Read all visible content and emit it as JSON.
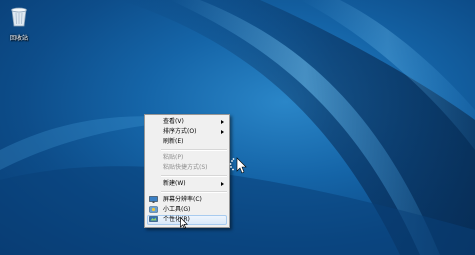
{
  "desktop": {
    "icons": [
      {
        "label": "回收站",
        "icon": "recycle-bin-icon"
      }
    ],
    "colors": {
      "background": "#1565a8",
      "accent": "#2a86c8"
    }
  },
  "context_menu": {
    "items": [
      {
        "label": "查看(V)",
        "submenu": true
      },
      {
        "label": "排序方式(O)",
        "submenu": true
      },
      {
        "label": "刷新(E)"
      },
      {
        "separator": true
      },
      {
        "label": "粘贴(P)",
        "disabled": true
      },
      {
        "label": "粘贴快捷方式(S)",
        "disabled": true
      },
      {
        "separator": true
      },
      {
        "label": "新建(W)",
        "submenu": true
      },
      {
        "separator": true
      },
      {
        "label": "屏幕分辨率(C)",
        "icon": "display-icon"
      },
      {
        "label": "小工具(G)",
        "icon": "gadgets-icon"
      },
      {
        "label": "个性化(R)",
        "icon": "personalize-icon",
        "hover": true
      }
    ]
  },
  "cursors": {
    "busy": "busy-cursor",
    "pointer": "arrow-cursor"
  }
}
